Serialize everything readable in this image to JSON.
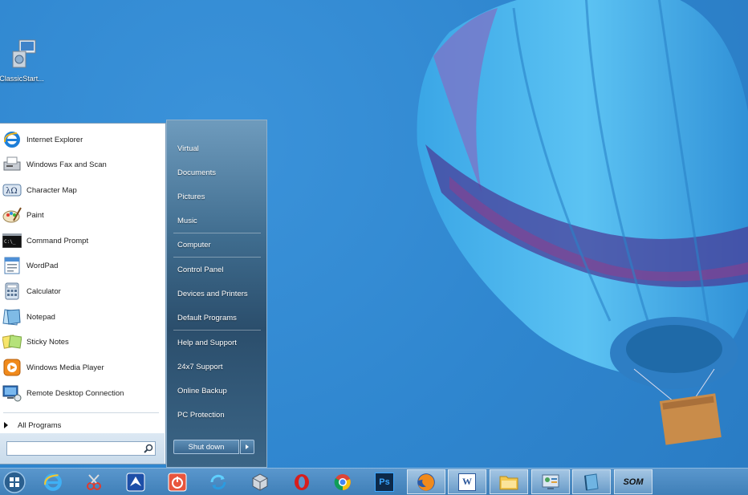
{
  "desktop": {
    "icon_label": "ClassicStart..."
  },
  "start_menu": {
    "programs": [
      {
        "label": "Internet Explorer",
        "icon": "internet-explorer-icon"
      },
      {
        "label": "Windows Fax and Scan",
        "icon": "fax-scan-icon"
      },
      {
        "label": "Character Map",
        "icon": "character-map-icon"
      },
      {
        "label": "Paint",
        "icon": "paint-icon"
      },
      {
        "label": "Command Prompt",
        "icon": "command-prompt-icon"
      },
      {
        "label": "WordPad",
        "icon": "wordpad-icon"
      },
      {
        "label": "Calculator",
        "icon": "calculator-icon"
      },
      {
        "label": "Notepad",
        "icon": "notepad-icon"
      },
      {
        "label": "Sticky Notes",
        "icon": "sticky-notes-icon"
      },
      {
        "label": "Windows Media Player",
        "icon": "media-player-icon"
      },
      {
        "label": "Remote Desktop Connection",
        "icon": "remote-desktop-icon"
      }
    ],
    "all_programs": "All Programs",
    "search_placeholder": "",
    "places": [
      {
        "label": "Virtual"
      },
      {
        "label": "Documents"
      },
      {
        "label": "Pictures"
      },
      {
        "label": "Music"
      },
      {
        "label": "Computer"
      },
      {
        "label": "Control Panel"
      },
      {
        "label": "Devices and Printers"
      },
      {
        "label": "Default Programs"
      },
      {
        "label": "Help and Support"
      },
      {
        "label": "24x7 Support"
      },
      {
        "label": "Online Backup"
      },
      {
        "label": "PC Protection"
      }
    ],
    "shutdown_label": "Shut down"
  },
  "taskbar": {
    "buttons": [
      {
        "icon": "internet-explorer-icon"
      },
      {
        "icon": "snipping-tool-icon"
      },
      {
        "icon": "app-logo-icon"
      },
      {
        "icon": "power-app-icon"
      },
      {
        "icon": "sync-icon"
      },
      {
        "icon": "package-icon"
      },
      {
        "icon": "opera-icon"
      },
      {
        "icon": "chrome-icon"
      },
      {
        "icon": "photoshop-icon"
      },
      {
        "icon": "firefox-icon"
      },
      {
        "icon": "word-icon"
      },
      {
        "icon": "file-explorer-icon"
      },
      {
        "icon": "control-panel-icon"
      },
      {
        "icon": "book-icon"
      },
      {
        "icon": "som-icon"
      }
    ],
    "photoshop_text": "Ps",
    "word_text": "W",
    "som_text": "SOM"
  }
}
